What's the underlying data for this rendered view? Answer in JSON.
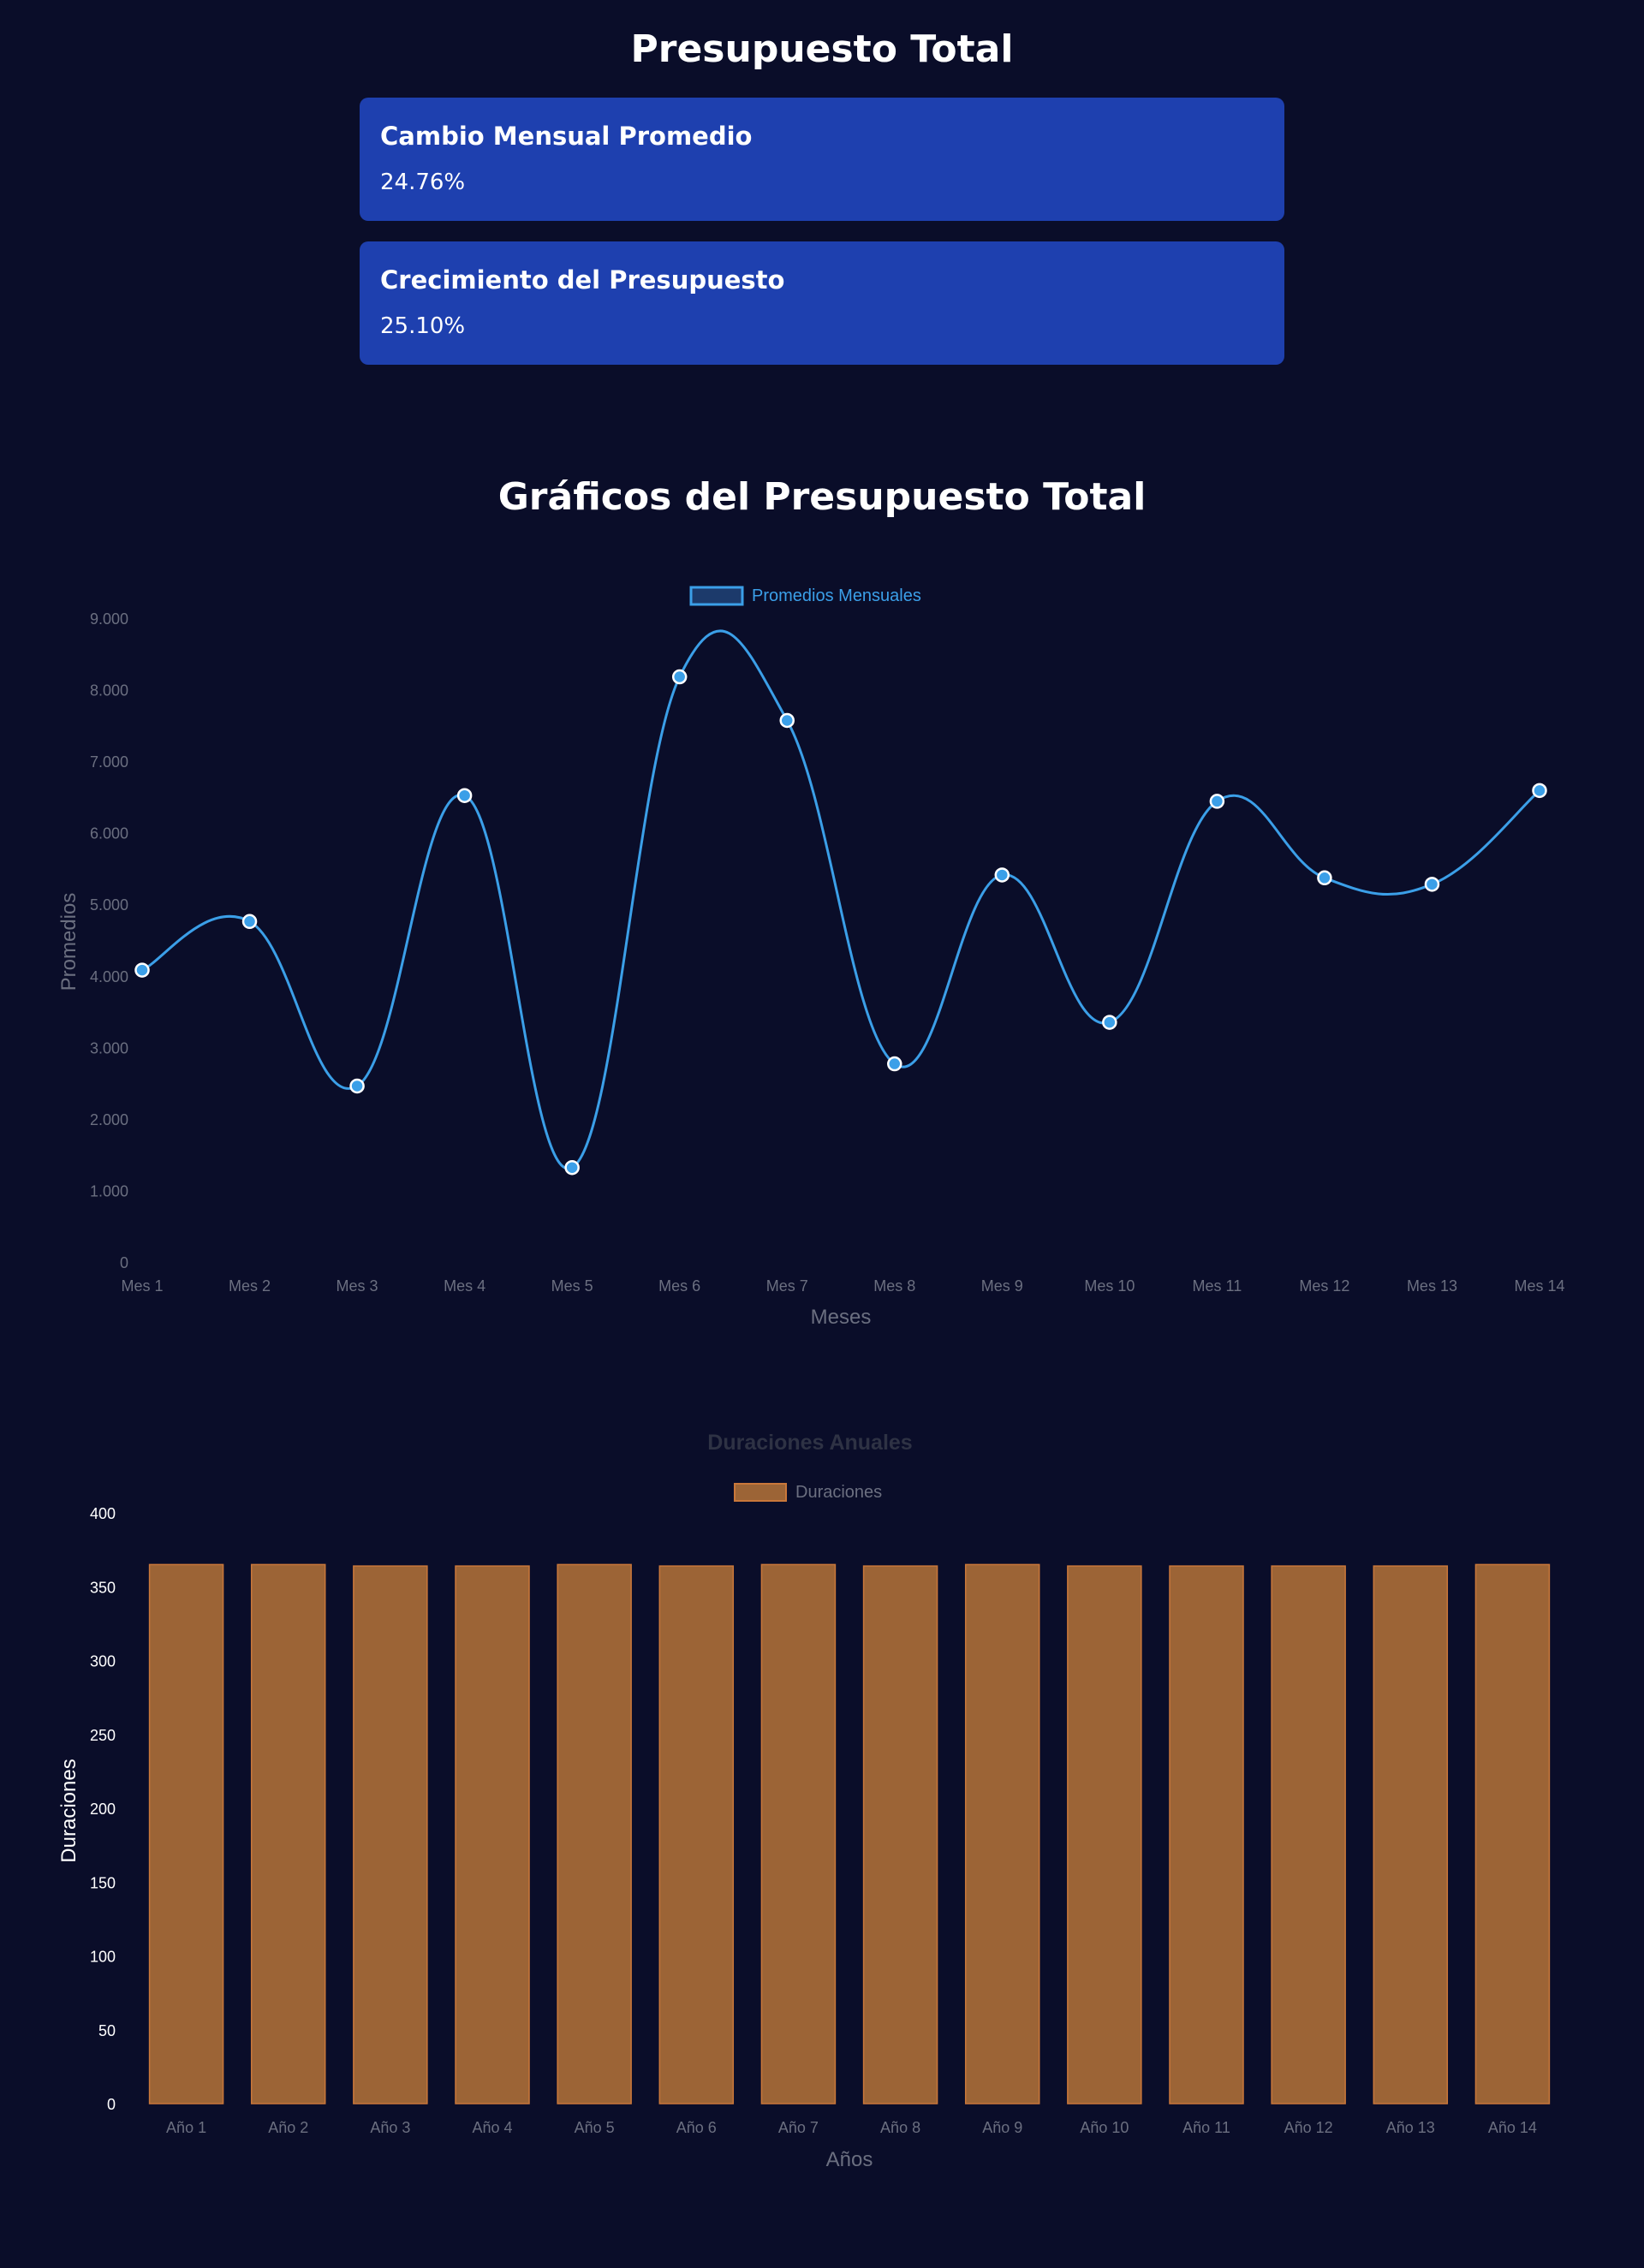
{
  "header": {
    "title": "Presupuesto Total"
  },
  "stats": [
    {
      "label": "Cambio Mensual Promedio",
      "value": "24.76%"
    },
    {
      "label": "Crecimiento del Presupuesto",
      "value": "25.10%"
    }
  ],
  "section": {
    "title": "Gráficos del Presupuesto Total"
  },
  "colors": {
    "background": "#0a0d29",
    "card": "#1e40af",
    "line": "#3b9fe8",
    "bar_fill": "#9c6436",
    "bar_border": "#c9773a",
    "muted_text": "#6b6f80"
  },
  "chart_data": [
    {
      "type": "line",
      "title": "",
      "legend": "Promedios Mensuales",
      "legend_position": "top",
      "xlabel": "Meses",
      "ylabel": "Promedios",
      "categories": [
        "Mes 1",
        "Mes 2",
        "Mes 3",
        "Mes 4",
        "Mes 5",
        "Mes 6",
        "Mes 7",
        "Mes 8",
        "Mes 9",
        "Mes 10",
        "Mes 11",
        "Mes 12",
        "Mes 13",
        "Mes 14"
      ],
      "values": [
        4080,
        4760,
        2460,
        6520,
        1320,
        8180,
        7570,
        2770,
        5410,
        3350,
        6440,
        5370,
        5280,
        6590
      ],
      "ylim": [
        0,
        9000
      ],
      "yticks": [
        "0",
        "1.000",
        "2.000",
        "3.000",
        "4.000",
        "5.000",
        "6.000",
        "7.000",
        "8.000",
        "9.000"
      ],
      "grid": false,
      "smooth": true
    },
    {
      "type": "bar",
      "title": "Duraciones Anuales",
      "legend": "Duraciones",
      "legend_position": "top",
      "xlabel": "Años",
      "ylabel": "Duraciones",
      "categories": [
        "Año 1",
        "Año 2",
        "Año 3",
        "Año 4",
        "Año 5",
        "Año 6",
        "Año 7",
        "Año 8",
        "Año 9",
        "Año 10",
        "Año 11",
        "Año 12",
        "Año 13",
        "Año 14"
      ],
      "values": [
        365,
        365,
        364,
        364,
        365,
        364,
        365,
        364,
        365,
        364,
        364,
        364,
        364,
        365
      ],
      "ylim": [
        0,
        400
      ],
      "yticks": [
        "0",
        "50",
        "100",
        "150",
        "200",
        "250",
        "300",
        "350",
        "400"
      ],
      "grid": false
    }
  ]
}
